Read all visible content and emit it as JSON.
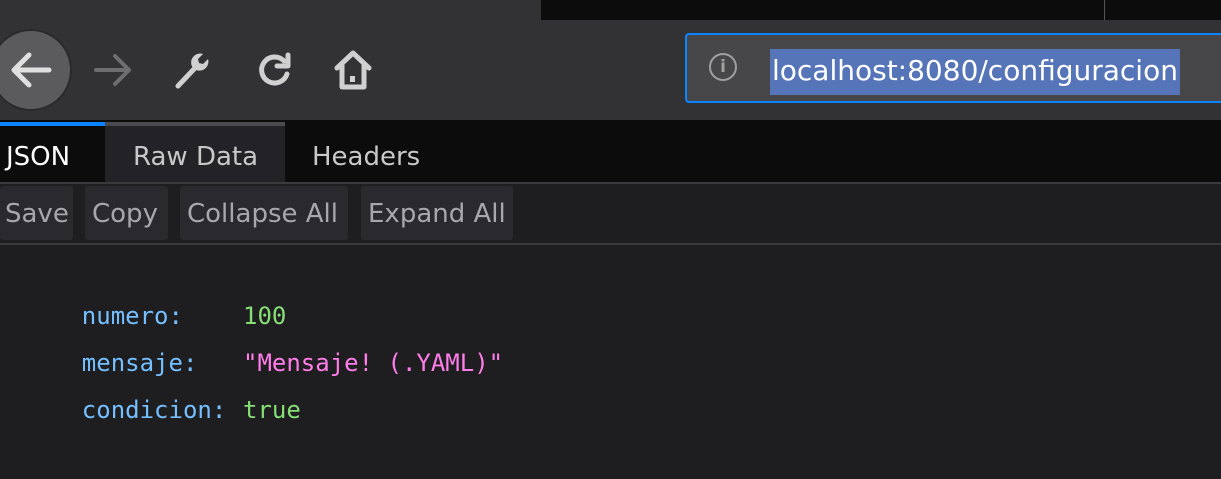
{
  "browser": {
    "url": "localhost:8080/configuracion",
    "icons": [
      "back-arrow-icon",
      "forward-arrow-icon",
      "wrench-icon",
      "reload-icon",
      "home-icon",
      "info-icon"
    ]
  },
  "tabs": [
    {
      "label": "JSON",
      "active": true
    },
    {
      "label": "Raw Data",
      "active": false
    },
    {
      "label": "Headers",
      "active": false
    }
  ],
  "toolbar": {
    "save": "Save",
    "copy": "Copy",
    "collapse_all": "Collapse All",
    "expand_all": "Expand All"
  },
  "json": [
    {
      "key": "numero:",
      "value": "100"
    },
    {
      "key": "mensaje:",
      "value": "\"Mensaje! (.YAML)\""
    },
    {
      "key": "condicion:",
      "value": "true"
    }
  ]
}
